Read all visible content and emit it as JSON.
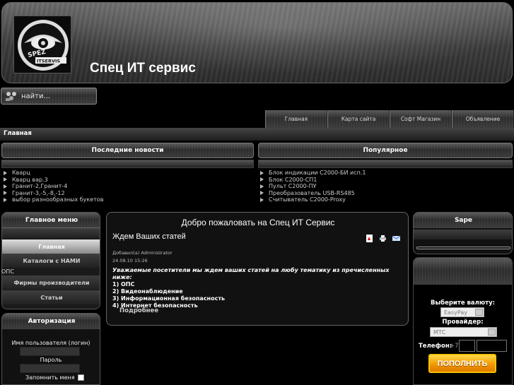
{
  "header": {
    "logo_text": "SPEZ ITSERVIS",
    "title": "Спец ИТ сервис"
  },
  "search": {
    "value": "найти..."
  },
  "topnav": [
    "Главная",
    "Карта сайта",
    "Софт Магазин",
    "Объявление"
  ],
  "breadcrumb": "Главная",
  "latest_news": {
    "title": "Последние новости",
    "items": [
      "Кварц",
      "Кварц вар.3",
      "Гранит-2,Гранит-4",
      "Гранит-3,-5,-8,-12",
      "выбор разнообразных букетов"
    ]
  },
  "popular": {
    "title": "Популярное",
    "items": [
      "Блок индикации С2000-БИ исп.1",
      "Блок С2000-СП1",
      "Пульт С2000-ПУ",
      "Преобразователь USB-RS485",
      "Считыватель С2000-Proxy"
    ]
  },
  "main_menu": {
    "title": "Главное меню",
    "items": [
      "Главная",
      "Каталоги с НАМИ",
      "Фирмы производители",
      "Статьи"
    ],
    "stray_label": "ОПС"
  },
  "auth": {
    "title": "Авторизация",
    "username_label": "Имя пользователя (логин)",
    "password_label": "Пароль",
    "remember_label": "Запомнить меня"
  },
  "content": {
    "welcome": "Добро пожаловать на Спец ИТ Сервис",
    "article_title": "Ждем Ваших статей",
    "author": "Добавил(а) Administrator",
    "date": "24.08.10 15:26",
    "intro": "Уважаемые посетители мы ждем ваших статей на любу тематику из  пречисленных ниже:",
    "list": [
      "1) ОПС",
      "2) Видеонаблюдение",
      "3) Информационная безопасность",
      "4) Интернет безопасность"
    ],
    "read_more": "Подробнее"
  },
  "sape": {
    "title": "Sape"
  },
  "payment": {
    "currency_label": "Выберите валюту:",
    "currency_value": "EasyPay",
    "provider_label": "Провайдер:",
    "provider_value": "МТС",
    "phone_label": "Телефон:",
    "phone_prefix": "+7",
    "button_label": "ПОПОЛНИТЬ"
  },
  "colors": {
    "background": "#000000",
    "pay_button": "#f29a00",
    "text": "#ffffff"
  }
}
